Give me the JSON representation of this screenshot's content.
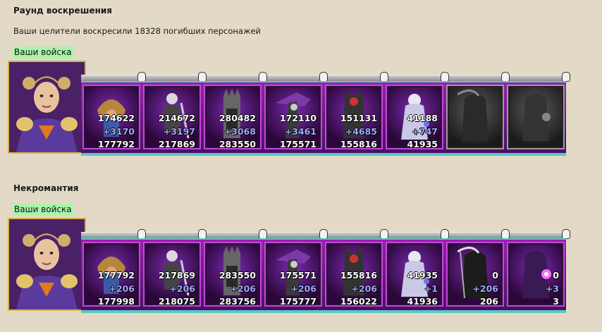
{
  "round1": {
    "title": "Раунд воскрешения",
    "description": "Ваши целители воскресили 18328 погибших персонажей",
    "badge": "Ваши войска",
    "units": [
      {
        "name": "ogre-unit",
        "count": "174622",
        "delta": "+3170",
        "total": "177792",
        "style": "ogre"
      },
      {
        "name": "skeleton-warrior-unit",
        "count": "214672",
        "delta": "+3197",
        "total": "217869",
        "style": "skel"
      },
      {
        "name": "spiked-knight-unit",
        "count": "280482",
        "delta": "+3068",
        "total": "283550",
        "style": "spike"
      },
      {
        "name": "bone-dragon-unit",
        "count": "172110",
        "delta": "+3461",
        "total": "175571",
        "style": "dragon"
      },
      {
        "name": "demon-knight-unit",
        "count": "151131",
        "delta": "+4685",
        "total": "155816",
        "style": "demon"
      },
      {
        "name": "ghost-maiden-unit",
        "count": "41188",
        "delta": "+747",
        "total": "41935",
        "style": "ghost"
      },
      {
        "name": "reaper-unit",
        "count": "",
        "delta": "",
        "total": "",
        "style": "reaper-gray"
      },
      {
        "name": "lich-unit",
        "count": "",
        "delta": "",
        "total": "",
        "style": "lich-gray"
      }
    ]
  },
  "round2": {
    "title": "Некромантия",
    "badge": "Ваши войска",
    "units": [
      {
        "name": "ogre-unit",
        "count": "177792",
        "delta": "+206",
        "total": "177998",
        "style": "ogre"
      },
      {
        "name": "skeleton-warrior-unit",
        "count": "217869",
        "delta": "+206",
        "total": "218075",
        "style": "skel"
      },
      {
        "name": "spiked-knight-unit",
        "count": "283550",
        "delta": "+206",
        "total": "283756",
        "style": "spike"
      },
      {
        "name": "bone-dragon-unit",
        "count": "175571",
        "delta": "+206",
        "total": "175777",
        "style": "dragon"
      },
      {
        "name": "demon-knight-unit",
        "count": "155816",
        "delta": "+206",
        "total": "156022",
        "style": "demon"
      },
      {
        "name": "ghost-maiden-unit",
        "count": "41935",
        "delta": "+1",
        "total": "41936",
        "style": "ghost"
      },
      {
        "name": "reaper-unit",
        "count": "0",
        "delta": "+206",
        "total": "206",
        "style": "reaper"
      },
      {
        "name": "lich-unit",
        "count": "0",
        "delta": "+3",
        "total": "3",
        "style": "lich"
      }
    ]
  },
  "colors": {
    "background": "#e2dac6",
    "badge": "#a9f5a9",
    "delta_text": "#a7a7ff",
    "strip_purple": "#9a1fae",
    "strip_teal": "#57c8c2"
  }
}
